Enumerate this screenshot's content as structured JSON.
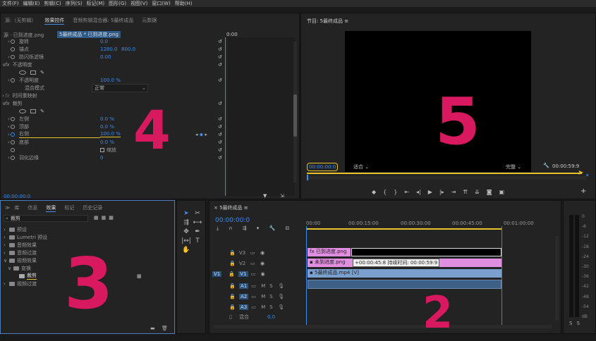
{
  "menu": [
    "文件(F)",
    "编辑(E)",
    "剪辑(C)",
    "序列(S)",
    "标记(M)",
    "图形(G)",
    "视图(V)",
    "窗口(W)",
    "帮助(H)"
  ],
  "effect_panel": {
    "tabs": [
      "源:（无剪辑）",
      "效果控件",
      "音频剪辑混合器: 5最终成品",
      "元数据"
    ],
    "source_label": "源 · 已到进度.png",
    "clip_label": "5最终成品 * 已到进度.png",
    "ruler_time": "0:00",
    "rows": [
      {
        "label": "旋转",
        "value": "0.0"
      },
      {
        "label": "锚点",
        "value": "1280.0",
        "value2": "800.0"
      },
      {
        "label": "防闪烁滤镜",
        "value": "0.00"
      },
      {
        "label": "不透明度",
        "value": ""
      },
      {
        "label": "不透明度",
        "value": "100.0 %"
      },
      {
        "label": "混合模式",
        "value": "正常"
      },
      {
        "label": "时间重映射",
        "value": ""
      },
      {
        "label": "裁剪",
        "value": ""
      },
      {
        "label": "左侧",
        "value": "0.0 %"
      },
      {
        "label": "顶部",
        "value": "0.0 %"
      },
      {
        "label": "右侧",
        "value": "100.0 %"
      },
      {
        "label": "底部",
        "value": "0.0 %"
      },
      {
        "label": "缩放",
        "value": ""
      },
      {
        "label": "羽化边缘",
        "value": "0"
      }
    ],
    "fx": "fx",
    "timecode": "00:00:00:0"
  },
  "program": {
    "title": "节目: 5最终成品",
    "timecode": "00:00:00:0",
    "fit": "适合",
    "quality": "完整",
    "duration": "00:00:59:9"
  },
  "effects": {
    "tabs": [
      "库",
      "信息",
      "效果",
      "标记",
      "历史记录"
    ],
    "search": "裁剪",
    "tree": [
      "预设",
      "Lumetri 预设",
      "音频效果",
      "音频过渡",
      "视频效果",
      "变换",
      "裁剪",
      "视频过渡"
    ]
  },
  "timeline": {
    "title": "5最终成品",
    "timecode": "00:00:00:0",
    "ruler": [
      "00:00",
      "00:00:15:00",
      "00:00:30:00",
      "00:00:45:00",
      "00:01:00:00"
    ],
    "video_tracks": [
      "V3",
      "V2",
      "V1"
    ],
    "audio_tracks": [
      "A1",
      "A2",
      "A3"
    ],
    "src_v": "V1",
    "mix_label": "混合",
    "mix_value": "0.0",
    "clips": {
      "v3": "已到进度.png",
      "v2": "未到进度.png",
      "v1": "5最终成品.mp4 [V]"
    },
    "tooltip": "+00:00:45:8 持续时间: 00:00:59:9"
  },
  "meter_labels": [
    "0",
    "-6",
    "-12",
    "-18",
    "-24",
    "-30",
    "-36",
    "-42",
    "-48",
    "-54",
    "dB"
  ],
  "annotations": {
    "a2": "2",
    "a3": "3",
    "a4": "4",
    "a5": "5"
  }
}
